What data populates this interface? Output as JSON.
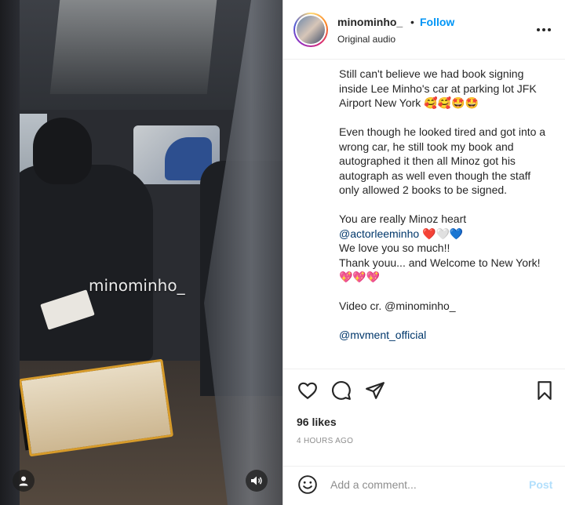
{
  "video": {
    "watermark": "minominho_",
    "user_icon": "user-icon",
    "sound_icon": "speaker-icon"
  },
  "header": {
    "username": "minominho_",
    "separator": "•",
    "follow_label": "Follow",
    "audio_label": "Original audio",
    "more_icon": "more-options-icon"
  },
  "caption": {
    "para1": "Still can't believe we had book signing inside Lee Minho's car at parking lot JFK Airport New York 🥰🥰🤩🤩",
    "para2": "Even though he looked tired and got into a wrong car, he still took my book and autographed it then all Minoz got his autograph as well even though the staff only allowed 2 books to be signed.",
    "para3_line1": "You are really Minoz heart",
    "para3_mention": "@actorleeminho",
    "para3_hearts": " ❤️🤍💙",
    "para3_line3": "We love you so much!!",
    "para3_line4": "Thank youu... and Welcome to New York! 💖💖💖",
    "video_credit": "Video cr. @minominho_",
    "mention_cut": "@mvment_official"
  },
  "actions": {
    "like_icon": "heart-icon",
    "comment_icon": "comment-icon",
    "share_icon": "share-icon",
    "save_icon": "bookmark-icon"
  },
  "stats": {
    "likes": "96 likes",
    "time": "4 HOURS AGO"
  },
  "comment": {
    "placeholder": "Add a comment...",
    "post_label": "Post",
    "emoji_icon": "emoji-icon"
  },
  "colors": {
    "accent": "#0095f6",
    "mention": "#00376b",
    "post_disabled": "#b2dffc"
  }
}
